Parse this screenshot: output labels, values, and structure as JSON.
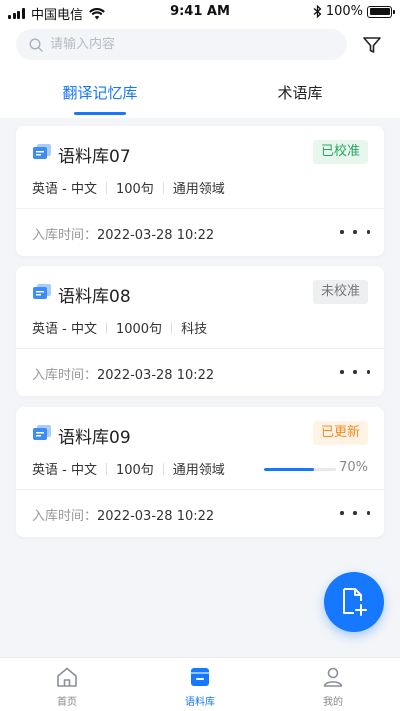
{
  "status_bar": {
    "carrier": "中国电信",
    "time": "9:41 AM",
    "battery": "100%"
  },
  "search": {
    "placeholder": "请输入内容"
  },
  "tabs": [
    {
      "label": "翻译记忆库",
      "active": true
    },
    {
      "label": "术语库",
      "active": false
    }
  ],
  "cards": [
    {
      "title": "语料库07",
      "status": "已校准",
      "status_color": "#29a45e",
      "lang_pair": "英语 - 中文",
      "count": "100句",
      "domain": "通用领域",
      "time_label": "入库时间：",
      "time": "2022-03-28 10:22"
    },
    {
      "title": "语料库08",
      "status": "未校准",
      "status_color": "#777777",
      "lang_pair": "英语 - 中文",
      "count": "1000句",
      "domain": "科技",
      "time_label": "入库时间：",
      "time": "2022-03-28 10:22"
    },
    {
      "title": "语料库09",
      "status": "已更新",
      "status_color": "#f08c21",
      "lang_pair": "英语 - 中文",
      "count": "100句",
      "domain": "通用领域",
      "progress": 0.7,
      "progress_text": "70%",
      "time_label": "入库时间：",
      "time": "2022-03-28 10:22"
    }
  ],
  "fab": {
    "icon": "add-file-icon"
  },
  "tabbar": [
    {
      "label": "首页",
      "icon": "home-icon",
      "active": false
    },
    {
      "label": "语料库",
      "icon": "corpus-icon",
      "active": true
    },
    {
      "label": "我的",
      "icon": "user-icon",
      "active": false
    }
  ],
  "colors": {
    "accent": "#1677ff",
    "background": "#f3f5f8"
  }
}
